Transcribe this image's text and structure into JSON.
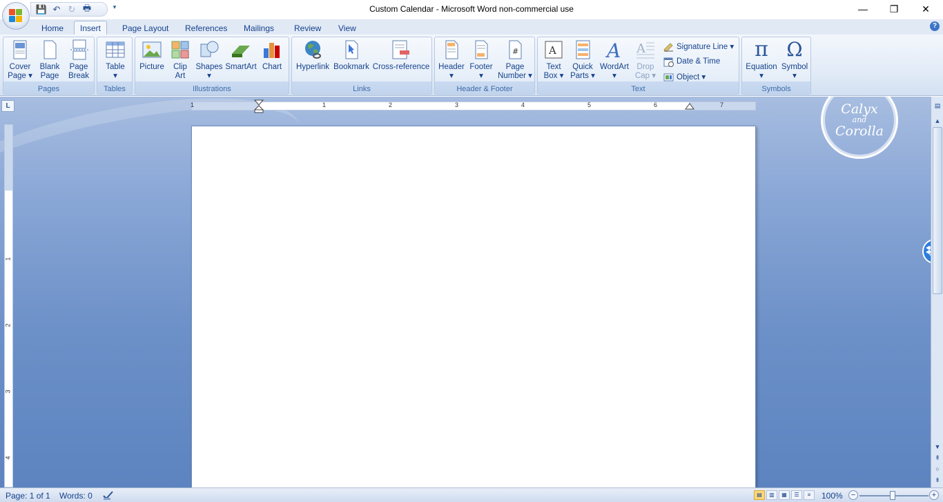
{
  "window": {
    "title": "Custom Calendar - Microsoft Word non-commercial use",
    "minimize": "—",
    "restore": "❐",
    "close": "✕"
  },
  "qat": {
    "save_icon": "💾",
    "undo_icon": "↶",
    "redo_icon": "↻",
    "print_icon": "🖶",
    "customize_icon": "▾"
  },
  "tabs": [
    {
      "label": "Home"
    },
    {
      "label": "Insert",
      "active": true
    },
    {
      "label": "Page Layout"
    },
    {
      "label": "References"
    },
    {
      "label": "Mailings"
    },
    {
      "label": "Review"
    },
    {
      "label": "View"
    }
  ],
  "help": "?",
  "ribbon": {
    "pages": {
      "label": "Pages",
      "cover_page": "Cover",
      "cover_page2": "Page ▾",
      "blank_page": "Blank",
      "blank_page2": "Page",
      "page_break": "Page",
      "page_break2": "Break"
    },
    "tables": {
      "label": "Tables",
      "table": "Table",
      "table2": "▾"
    },
    "illustrations": {
      "label": "Illustrations",
      "picture": "Picture",
      "clip_art": "Clip",
      "clip_art2": "Art",
      "shapes": "Shapes",
      "shapes2": "▾",
      "smartart": "SmartArt",
      "chart": "Chart"
    },
    "links": {
      "label": "Links",
      "hyperlink": "Hyperlink",
      "bookmark": "Bookmark",
      "cross_reference": "Cross-reference"
    },
    "header_footer": {
      "label": "Header & Footer",
      "header": "Header",
      "header2": "▾",
      "footer": "Footer",
      "footer2": "▾",
      "page_number": "Page",
      "page_number2": "Number ▾"
    },
    "text": {
      "label": "Text",
      "text_box": "Text",
      "text_box2": "Box ▾",
      "quick_parts": "Quick",
      "quick_parts2": "Parts ▾",
      "wordart": "WordArt",
      "wordart2": "▾",
      "drop_cap": "Drop",
      "drop_cap2": "Cap ▾",
      "signature_line": "Signature Line ▾",
      "date_time": "Date & Time",
      "object": "Object ▾"
    },
    "symbols": {
      "label": "Symbols",
      "equation": "Equation",
      "equation2": "▾",
      "symbol": "Symbol",
      "symbol2": "▾",
      "equation_glyph": "π",
      "symbol_glyph": "Ω"
    }
  },
  "ruler": {
    "tab_selector": "L",
    "h_numbers": [
      "1",
      "1",
      "2",
      "3",
      "4",
      "5",
      "6",
      "7"
    ],
    "v_numbers": [
      "1",
      "2",
      "3",
      "4"
    ]
  },
  "watermark": {
    "line1": "Calyx",
    "line2": "and",
    "line3": "Corolla"
  },
  "status": {
    "page": "Page: 1 of 1",
    "words": "Words: 0",
    "zoom": "100%",
    "zoom_out": "−",
    "zoom_in": "+"
  }
}
